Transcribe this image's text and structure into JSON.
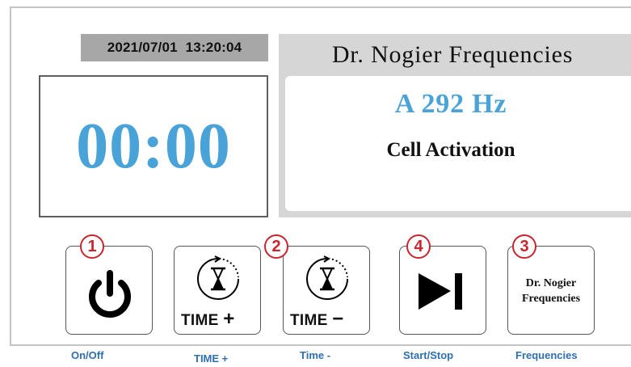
{
  "header": {
    "datetime": "2021/07/01  13:20:04"
  },
  "timer": {
    "display": "00:00",
    "color": "#4aa3d8"
  },
  "frequency_panel": {
    "title": "Dr. Nogier Frequencies",
    "value": "A 292 Hz",
    "name": "Cell Activation",
    "value_color": "#4aa3d8"
  },
  "buttons": {
    "onoff": {
      "icon": "power-icon",
      "badge": "1"
    },
    "time_plus": {
      "icon": "hourglass-icon",
      "label": "TIME",
      "sign": "+",
      "badge": "2"
    },
    "time_minus": {
      "icon": "hourglass-icon",
      "label": "TIME",
      "sign": "−"
    },
    "startstop": {
      "icon": "play-pause-icon",
      "badge": "4"
    },
    "frequencies": {
      "label_line1": "Dr. Nogier",
      "label_line2": "Frequencies",
      "badge": "3"
    }
  },
  "captions": {
    "onoff": "On/Off",
    "time_plus": "TIME +",
    "time_minus": "Time -",
    "startstop": "Start/Stop",
    "frequencies": "Frequencies"
  },
  "colors": {
    "badge": "#c8262e",
    "caption": "#2e6fb0",
    "panel_gray": "#d6d6d6",
    "datetime_gray": "#a7a7a7"
  }
}
